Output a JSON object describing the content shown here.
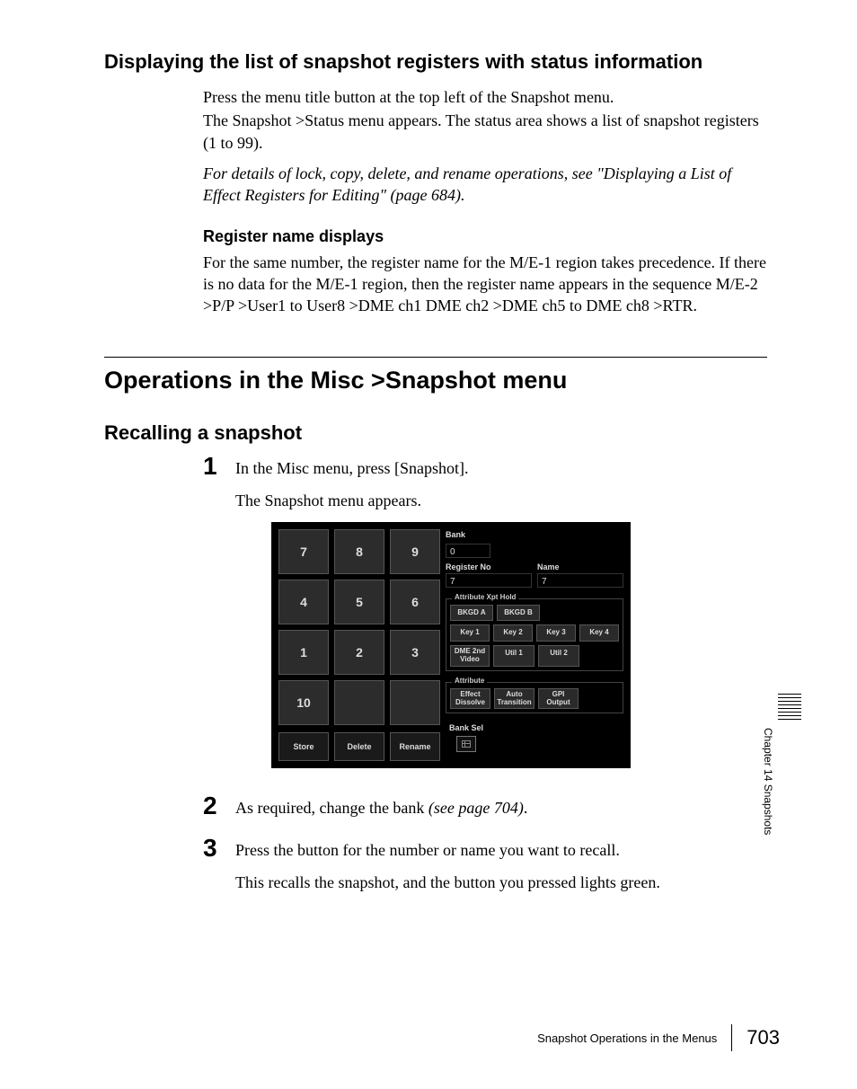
{
  "heading1": "Displaying the list of snapshot registers with status information",
  "intro": {
    "p1": "Press the menu title button at the top left of the Snapshot menu.",
    "p2": "The Snapshot >Status menu appears. The status area shows a  list of snapshot registers (1 to 99).",
    "italic": "For details of lock, copy, delete, and rename operations, see \"Displaying a List of Effect Registers for Editing\" (page 684)."
  },
  "regname": {
    "h": "Register name displays",
    "p": "For the same number, the register name for the M/E-1 region takes precedence. If there is no data for the M/E-1 region, then the register name appears in the sequence M/E-2 >P/P >User1 to User8 >DME ch1 DME ch2 >DME ch5 to DME ch8 >RTR."
  },
  "section": "Operations in the Misc >Snapshot menu",
  "heading2": "Recalling a snapshot",
  "steps": {
    "s1": {
      "num": "1",
      "p1": "In the Misc menu, press [Snapshot].",
      "p2": "The Snapshot menu appears."
    },
    "s2": {
      "num": "2",
      "p1a": "As required, change the bank ",
      "p1b": "(see page 704)",
      "p1c": "."
    },
    "s3": {
      "num": "3",
      "p1": "Press the button for the number or name you want to recall.",
      "p2": "This recalls the snapshot, and the button you pressed lights green."
    }
  },
  "snapshot": {
    "keypad": [
      [
        "7",
        "8",
        "9"
      ],
      [
        "4",
        "5",
        "6"
      ],
      [
        "1",
        "2",
        "3"
      ],
      [
        "10",
        "",
        ""
      ]
    ],
    "actions": [
      "Store",
      "Delete",
      "Rename"
    ],
    "bank_label": "Bank",
    "bank_value": "0",
    "regno_label": "Register No",
    "regno_value": "7",
    "name_label": "Name",
    "name_value": "7",
    "xpt": {
      "label": "Attribute Xpt Hold",
      "row1": [
        "BKGD A",
        "BKGD B"
      ],
      "row2": [
        "Key 1",
        "Key 2",
        "Key 3",
        "Key 4"
      ],
      "row3": [
        "DME 2nd\nVideo",
        "Util 1",
        "Util 2"
      ]
    },
    "attr": {
      "label": "Attribute",
      "row": [
        "Effect\nDissolve",
        "Auto\nTransition",
        "GPI\nOutput"
      ]
    },
    "banksel_label": "Bank Sel"
  },
  "sidetab": "Chapter 14  Snapshots",
  "footer": {
    "title": "Snapshot Operations in the Menus",
    "page": "703"
  }
}
